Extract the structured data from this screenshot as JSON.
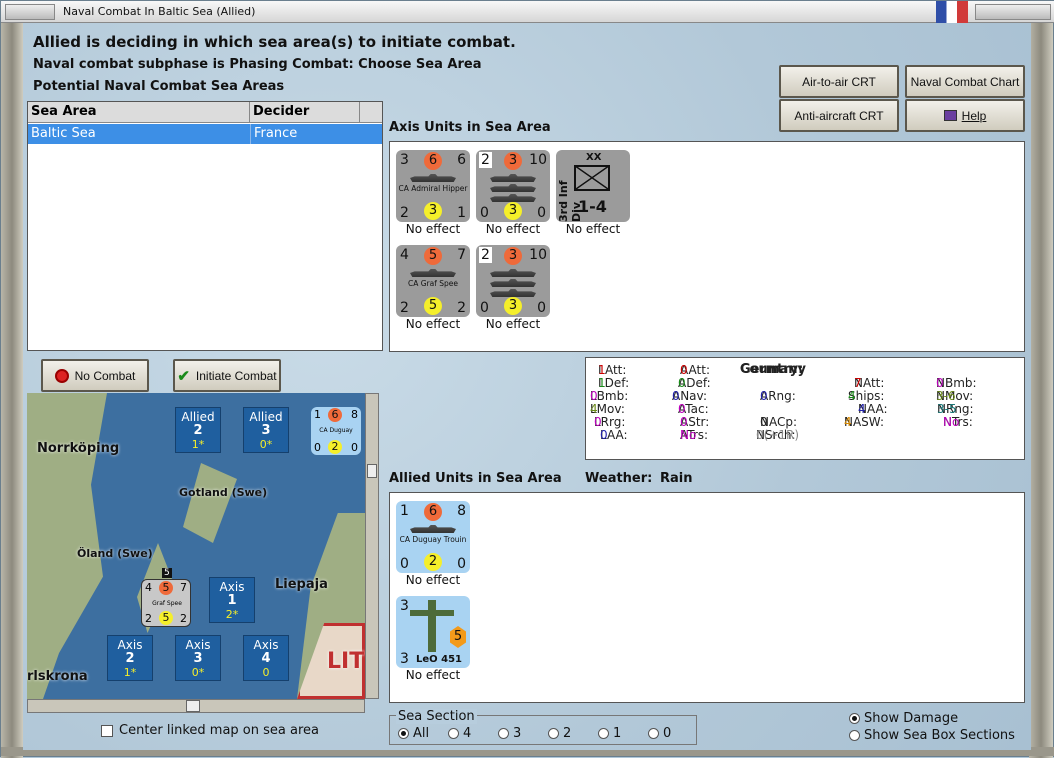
{
  "window": {
    "title": "Naval Combat In Baltic Sea (Allied)"
  },
  "header": {
    "line1": "Allied is deciding in which sea area(s) to initiate combat.",
    "line2": "Naval combat subphase is Phasing Combat: Choose Sea Area",
    "line3": "Potential Naval Combat Sea Areas"
  },
  "buttons": {
    "air_to_air": "Air-to-air CRT",
    "naval_chart": "Naval Combat Chart",
    "anti_aircraft": "Anti-aircraft CRT",
    "help": "Help",
    "no_combat": "No Combat",
    "initiate_combat": "Initiate Combat"
  },
  "table": {
    "headers": [
      "Sea Area",
      "Decider"
    ],
    "rows": [
      [
        "Baltic Sea",
        "France"
      ]
    ]
  },
  "axis_section": {
    "label": "Axis Units in Sea Area"
  },
  "axis_units": [
    {
      "tl": "3",
      "tc": "6",
      "tr": "6",
      "name": "CA Admiral Hipper",
      "bl": "2",
      "bc": "3",
      "br": "1",
      "effect": "No effect"
    },
    {
      "tl": "2",
      "tc": "3",
      "tr": "10",
      "name": "",
      "bl": "0",
      "bc": "3",
      "br": "0",
      "effect": "No effect"
    },
    {
      "type": "XX",
      "vname": "3rd Inf Div",
      "str": "1-4",
      "effect": "No effect"
    },
    {
      "tl": "4",
      "tc": "5",
      "tr": "7",
      "name": "CA Graf Spee",
      "bl": "2",
      "bc": "5",
      "br": "2",
      "effect": "No effect"
    },
    {
      "tl": "2",
      "tc": "3",
      "tr": "10",
      "name": "",
      "bl": "0",
      "bc": "3",
      "br": "0",
      "effect": "No effect"
    }
  ],
  "allied_section": {
    "label": "Allied Units in Sea Area",
    "weather_label": "Weather:",
    "weather": "Rain"
  },
  "allied_units": [
    {
      "tl": "1",
      "tc": "6",
      "tr": "8",
      "name": "CA Duguay Trouin",
      "bl": "0",
      "bc": "2",
      "br": "0",
      "effect": "No effect"
    },
    {
      "tl": "3",
      "tc": "5",
      "name": "LeO 451",
      "bl": "3",
      "effect": "No effect"
    }
  ],
  "stats": {
    "country_label": "Country:",
    "country": "Germany",
    "latt": [
      "LAtt:",
      "1"
    ],
    "ldef": [
      "LDef:",
      "1"
    ],
    "lbmb": [
      "LBmb:",
      "0"
    ],
    "lmov": [
      "LMov:",
      "4"
    ],
    "lrrg": [
      "LRrg:",
      "0"
    ],
    "laa": [
      "LAA:",
      "0"
    ],
    "aatt": [
      "AAtt:",
      "0"
    ],
    "adef": [
      "ADef:",
      "0"
    ],
    "anav": [
      "ANav:",
      "0"
    ],
    "atac": [
      "ATac:",
      "0"
    ],
    "astr": [
      "AStr:",
      "0"
    ],
    "atrs": [
      "ATrs:",
      "No"
    ],
    "arng": [
      "ARng:",
      "0"
    ],
    "nacp": [
      "NACp:",
      "0"
    ],
    "nsrch": [
      "NSrch:",
      "0(+1R)"
    ],
    "natt": [
      "NAtt:",
      "7"
    ],
    "ships": [
      "Ships:",
      "4"
    ],
    "naa": [
      "NAA:",
      "4"
    ],
    "nasw": [
      "NASW:",
      "4"
    ],
    "nbmb": [
      "NBmb:",
      "0"
    ],
    "nmov": [
      "NMov:",
      "3-6"
    ],
    "nrng": [
      "NRng:",
      "3-5"
    ],
    "ntrs": [
      "NTrs:",
      "No"
    ]
  },
  "map": {
    "labels": {
      "norrkoping": "Norrköping",
      "gotland": "Gotland (Swe)",
      "oland": "Öland (Swe)",
      "liepaja": "Liepaja",
      "karlskrona": "rlskrona",
      "lit": "LIT"
    },
    "tiles": [
      {
        "side": "Allied",
        "num": "2",
        "sub": "1*"
      },
      {
        "side": "Allied",
        "num": "3",
        "sub": "0*"
      },
      {
        "side": "Axis",
        "num": "1",
        "sub": "2*"
      },
      {
        "side": "Axis",
        "num": "2",
        "sub": "1*"
      },
      {
        "side": "Axis",
        "num": "3",
        "sub": "0*"
      },
      {
        "side": "Axis",
        "num": "4",
        "sub": "0"
      }
    ],
    "ship_counter": {
      "tl": "1",
      "tc": "6",
      "tr": "8",
      "name": "CA Duguay",
      "bl": "0",
      "bc": "2",
      "br": "0"
    },
    "ship_counter2": {
      "badge": "5",
      "tl": "4",
      "tc": "5",
      "tr": "7",
      "name": "Graf Spee",
      "bl": "2",
      "bc": "5",
      "br": "2"
    }
  },
  "center_map": "Center linked map on sea area",
  "sea_section": {
    "legend": "Sea Section",
    "options": [
      "All",
      "4",
      "3",
      "2",
      "1",
      "0"
    ],
    "selected": "All"
  },
  "display": {
    "show_damage": "Show Damage",
    "show_sections": "Show Sea Box Sections"
  },
  "colors": {
    "selected_row": "#3d8fe6",
    "attack_circle": "#ef6a3a",
    "defense_circle": "#f5ef2a"
  }
}
